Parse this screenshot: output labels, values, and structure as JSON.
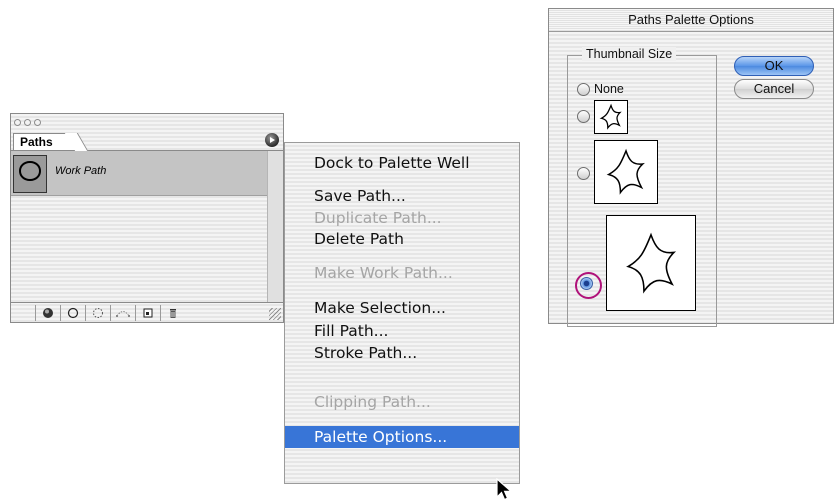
{
  "palette": {
    "tab_label": "Paths",
    "path_name": "Work Path",
    "bottom_buttons": [
      "fill-path-icon",
      "stroke-path-icon",
      "load-selection-icon",
      "make-work-path-icon",
      "new-path-icon",
      "trash-icon"
    ]
  },
  "menu": {
    "dock": "Dock to Palette Well",
    "save_path": "Save Path...",
    "duplicate_path": "Duplicate Path...",
    "delete_path": "Delete Path",
    "make_work_path": "Make Work Path...",
    "make_selection": "Make Selection...",
    "fill_path": "Fill Path...",
    "stroke_path": "Stroke Path...",
    "clipping_path": "Clipping Path...",
    "palette_options": "Palette Options..."
  },
  "dialog": {
    "title": "Paths Palette Options",
    "group_label": "Thumbnail Size",
    "none_label": "None",
    "ok_label": "OK",
    "cancel_label": "Cancel",
    "selected_option": "large"
  },
  "colors": {
    "menu_highlight": "#3875d7",
    "ok_button": "#5a95e8",
    "selection_ring": "#b0127a"
  }
}
